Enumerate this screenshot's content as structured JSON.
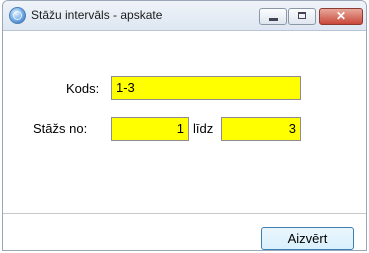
{
  "window": {
    "title": "Stāžu intervāls - apskate",
    "close_glyph": "✕"
  },
  "form": {
    "kods_label": "Kods:",
    "kods_value": "1-3",
    "stazs_label": "Stāžs no:",
    "from_value": "1",
    "lidz_label": "līdz",
    "to_value": "3"
  },
  "footer": {
    "close_button": "Aizvērt"
  },
  "colors": {
    "field_bg": "#ffff00",
    "close_ctrl": "#c9483a"
  }
}
